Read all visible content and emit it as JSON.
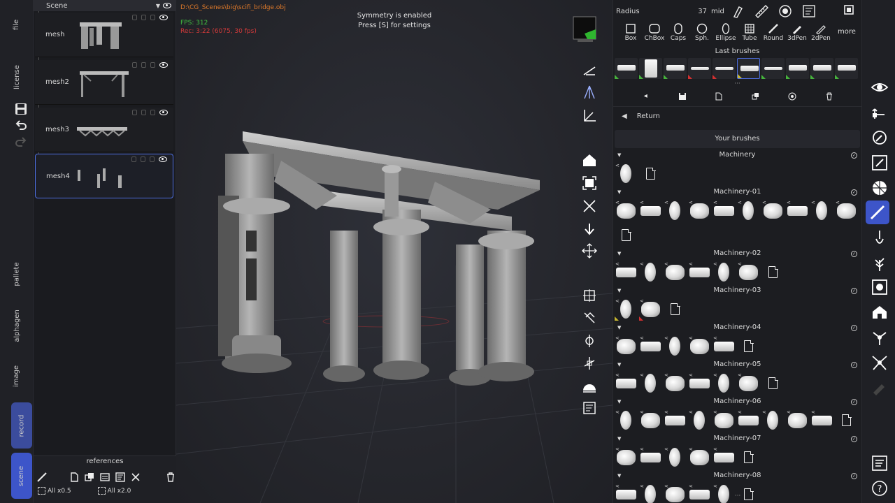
{
  "left_tabs": [
    "file",
    "license",
    "pallete",
    "alphagen",
    "image",
    "record",
    "scene"
  ],
  "scene": {
    "header": "Scene",
    "meshes": [
      {
        "name": "mesh"
      },
      {
        "name": "mesh2"
      },
      {
        "name": "mesh3"
      },
      {
        "name": "mesh4"
      }
    ],
    "references_label": "references",
    "scale_down_label": "All x0.5",
    "scale_up_label": "All x2.0"
  },
  "viewport": {
    "file_path": "D:\\CG_Scenes\\big\\scifi_bridge.obj",
    "fps": "FPS: 312",
    "rec": "Rec: 3:22 (6075, 30 fps)",
    "symmetry_msg": "Symmetry is enabled",
    "symmetry_hint": "Press [S] for settings"
  },
  "brush_panel": {
    "radius_label": "Radius",
    "radius_value": "37",
    "radius_mode": "mid",
    "shapes": [
      "Box",
      "ChBox",
      "Caps",
      "Sph.",
      "Ellipse",
      "Tube",
      "Round",
      "3dPen",
      "2dPen"
    ],
    "more_label": "more",
    "last_brushes_label": "Last brushes",
    "return_label": "Return",
    "your_brushes_label": "Your brushes",
    "groups": [
      {
        "name": "Machinery",
        "count": 1,
        "new": true
      },
      {
        "name": "Machinery-01",
        "count": 10,
        "new": true
      },
      {
        "name": "Machinery-02",
        "count": 6,
        "new": true
      },
      {
        "name": "Machinery-03",
        "count": 2,
        "new": true
      },
      {
        "name": "Machinery-04",
        "count": 5,
        "new": true
      },
      {
        "name": "Machinery-05",
        "count": 6,
        "new": true
      },
      {
        "name": "Machinery-06",
        "count": 9,
        "new": true
      },
      {
        "name": "Machinery-07",
        "count": 5,
        "new": true
      },
      {
        "name": "Machinery-08",
        "count": 5,
        "new": true
      }
    ]
  },
  "colors": {
    "accent": "#3d55c9",
    "selection": "#4d6ee0",
    "path_text": "#e07a2a",
    "fps_text": "#41c241",
    "rec_text": "#d43a3a"
  }
}
